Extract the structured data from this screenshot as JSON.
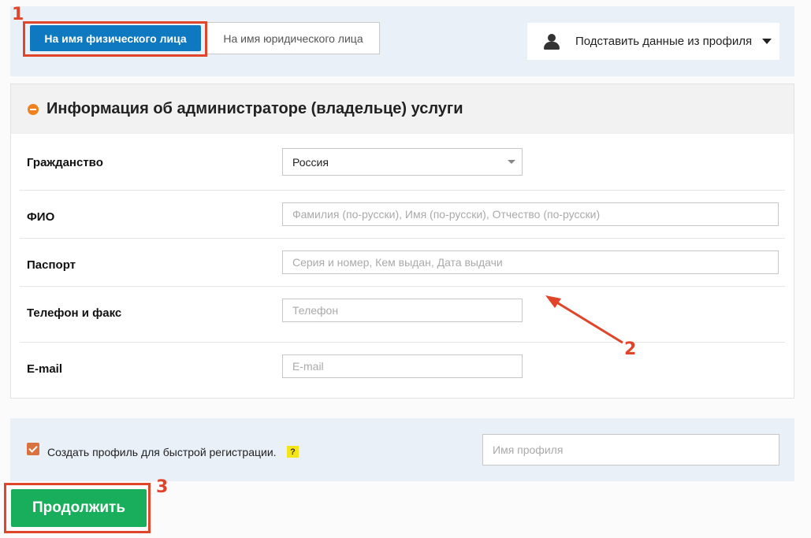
{
  "tabs": {
    "individual_label": "На имя физического лица",
    "legal_label": "На имя юридического лица"
  },
  "profile_dropdown": {
    "label": "Подставить данные из профиля",
    "icon": "user-icon"
  },
  "section": {
    "title": "Информация об администраторе (владельце) услуги",
    "collapse_icon": "minus-circle-icon"
  },
  "fields": {
    "citizenship": {
      "label": "Гражданство",
      "value": "Россия"
    },
    "full_name": {
      "label": "ФИО",
      "placeholder": "Фамилия (по-русски), Имя (по-русски), Отчество (по-русски)"
    },
    "passport": {
      "label": "Паспорт",
      "placeholder": "Серия и номер, Кем выдан, Дата выдачи"
    },
    "phone": {
      "label": "Телефон и факс",
      "placeholder": "Телефон"
    },
    "email": {
      "label": "E-mail",
      "placeholder": "E-mail"
    }
  },
  "profile": {
    "checkbox_label": "Создать профиль для быстрой регистрации.",
    "checked": true,
    "help": "?",
    "name_placeholder": "Имя профиля"
  },
  "continue_label": "Продолжить",
  "annotations": {
    "step1": "1",
    "step2": "2",
    "step3": "3"
  },
  "colors": {
    "primary_blue": "#0e79c0",
    "continue_green": "#19ae5b",
    "annotation_red": "#e0452a",
    "accent_orange": "#f0811f",
    "panel_bg": "#e9f0f8"
  }
}
